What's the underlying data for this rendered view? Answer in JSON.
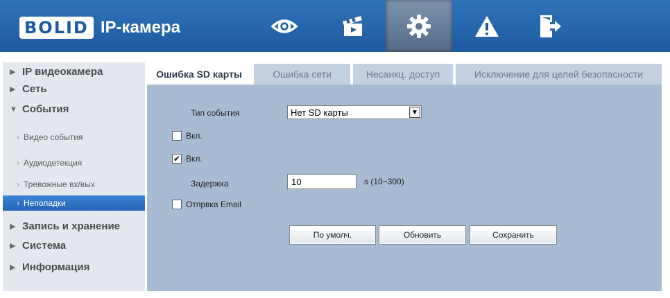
{
  "header": {
    "logo_brand": "BOLID",
    "logo_text": "IP-камера",
    "nav_icons": [
      "eye-icon",
      "clapperboard-icon",
      "gear-icon",
      "warning-icon",
      "logout-icon"
    ],
    "active_index": 2
  },
  "sidebar": {
    "items": [
      {
        "label": "IP видеокамера",
        "expanded": false
      },
      {
        "label": "Сеть",
        "expanded": false
      },
      {
        "label": "События",
        "expanded": true
      },
      {
        "label": "Видео события"
      },
      {
        "label": "Аудиодетекция"
      },
      {
        "label": "Тревожные вх/вых"
      },
      {
        "label": "Неполадки",
        "active": true
      },
      {
        "label": "Запись и хранение",
        "expanded": false
      },
      {
        "label": "Система",
        "expanded": false
      },
      {
        "label": "Информация",
        "expanded": false
      }
    ]
  },
  "tabs": [
    {
      "label": "Ошибка SD карты",
      "active": true
    },
    {
      "label": "Ошибка сети"
    },
    {
      "label": "Несанкц. доступ"
    },
    {
      "label": "Исключение для целей безопасности"
    }
  ],
  "form": {
    "event_type_label": "Тип события",
    "event_type_value": "Нет SD карты",
    "enable1_label": "Вкл.",
    "enable1_checked": false,
    "enable2_label": "Вкл.",
    "enable2_checked": true,
    "delay_label": "Задержка",
    "delay_value": "10",
    "delay_hint": "s (10~300)",
    "email_label": "Отпрвка Email",
    "email_checked": false
  },
  "buttons": {
    "default": "По умолч.",
    "refresh": "Обновить",
    "save": "Сохранить"
  },
  "colors": {
    "header": "#2a6bb3",
    "sidebar_bg": "#e4e8ee",
    "active_item": "#2f72c4",
    "content_bg": "#a9bbd3"
  }
}
